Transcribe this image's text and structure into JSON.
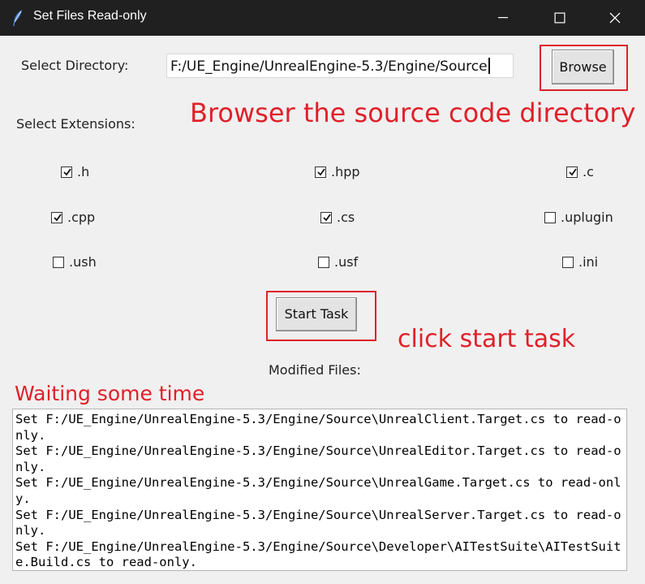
{
  "window": {
    "title": "Set Files Read-only"
  },
  "form": {
    "dir_label": "Select Directory:",
    "dir_value": "F:/UE_Engine/UnrealEngine-5.3/Engine/Source",
    "browse_label": "Browse",
    "ext_label": "Select Extensions:",
    "start_label": "Start Task",
    "modified_label": "Modified Files:"
  },
  "extensions": [
    {
      "label": ".h",
      "checked": true
    },
    {
      "label": ".hpp",
      "checked": true
    },
    {
      "label": ".c",
      "checked": true
    },
    {
      "label": ".cpp",
      "checked": true
    },
    {
      "label": ".cs",
      "checked": true
    },
    {
      "label": ".uplugin",
      "checked": false
    },
    {
      "label": ".ush",
      "checked": false
    },
    {
      "label": ".usf",
      "checked": false
    },
    {
      "label": ".ini",
      "checked": false
    }
  ],
  "annotations": {
    "browse": "Browser the source code directory",
    "start": "click start task",
    "wait": "Waiting some time"
  },
  "log": [
    "Set F:/UE_Engine/UnrealEngine-5.3/Engine/Source\\UnrealClient.Target.cs to read-only.",
    "Set F:/UE_Engine/UnrealEngine-5.3/Engine/Source\\UnrealEditor.Target.cs to read-only.",
    "Set F:/UE_Engine/UnrealEngine-5.3/Engine/Source\\UnrealGame.Target.cs to read-only.",
    "Set F:/UE_Engine/UnrealEngine-5.3/Engine/Source\\UnrealServer.Target.cs to read-only.",
    "Set F:/UE_Engine/UnrealEngine-5.3/Engine/Source\\Developer\\AITestSuite\\AITestSuite.Build.cs to read-only."
  ],
  "colors": {
    "annotation": "#e0202a",
    "titlebar": "#202020"
  },
  "icons": {
    "app": "feather-icon",
    "minimize": "minimize-icon",
    "maximize": "maximize-icon",
    "close": "close-icon"
  }
}
